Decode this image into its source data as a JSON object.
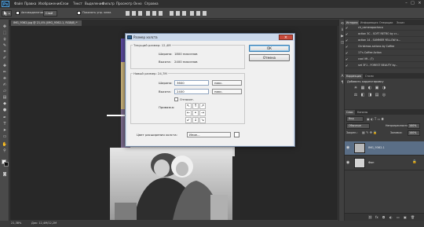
{
  "menubar": {
    "logo": "Ps",
    "items": [
      "Файл",
      "Правка",
      "Изображение",
      "Слои",
      "Текст",
      "Выделение",
      "Фильтр",
      "Просмотр",
      "Окно",
      "Справка"
    ],
    "window_controls": [
      "–",
      "□",
      "×"
    ]
  },
  "options": {
    "auto_select_label": "Автовыделение",
    "auto_select_target": "Слой",
    "show_transform_label": "Показать упр. элем."
  },
  "document": {
    "tab_label": "IMG_9362.jpg @ 21,4% (IMG_9362-1, RGB/8) *"
  },
  "status": {
    "zoom": "21,38%",
    "doc_size": "Док: 12,4M/12,2M"
  },
  "dialog": {
    "title": "Размер холста",
    "close": "×",
    "current_size": {
      "heading": "Текущий размер: 12,4M",
      "width_label": "Ширина:",
      "width_value": "1800 пикселов",
      "height_label": "Высота:",
      "height_value": "2400 пикселов"
    },
    "new_size": {
      "heading": "Новый размер: 24,7M",
      "width_label": "Ширина:",
      "width_value": "3600",
      "width_unit": "пикс.",
      "height_label": "Высота:",
      "height_value": "2400",
      "height_unit": "пикс.",
      "relative_label": "Относит.",
      "anchor_label": "Привязка:",
      "anchor_cells": [
        "↖",
        "↑",
        "↗",
        "←",
        "•",
        "→",
        "↙",
        "↓",
        "↘"
      ]
    },
    "extension_color": {
      "label": "Цвет расширения холста:",
      "value": "Иное..."
    },
    "ok_label": "ОК",
    "cancel_label": "Отмена"
  },
  "panels": {
    "top_tabs": [
      "История",
      "Информация",
      "Операции",
      "Эскиз"
    ],
    "history": [
      "ch_camerapacheco",
      "action 3C - SOFT RETRO by cr...",
      "action 14 - SUMMER YELLOW b...",
      "Christmas actions by Coffee",
      "17's Coffee Action",
      "cool lift - (?)",
      "set 3F1 - FOREST BEAUTY by..."
    ],
    "adjust_tabs": [
      "Коррекция",
      "Стили"
    ],
    "adjust_title": "Добавить корректировку",
    "adjust_icons_row1": [
      "☀",
      "▦",
      "◐",
      "▣",
      "◑"
    ],
    "adjust_icons_row2": [
      "⚖",
      "◧",
      "◨",
      "▤",
      "◎"
    ],
    "layers_tabs": [
      "Слои",
      "Каналы"
    ],
    "layers_kind": "Вид",
    "blend_mode": "Обычные",
    "opacity_label": "Непрозрачность:",
    "opacity_value": "100%",
    "lock_label": "Закреп.:",
    "fill_label": "Заливка:",
    "fill_value": "100%",
    "layers": [
      {
        "name": "IMG_9362-1"
      },
      {
        "name": "Фон"
      }
    ],
    "bottom_icons": [
      "⛓",
      "fx",
      "◘",
      "◐",
      "▭",
      "▣",
      "🗑"
    ]
  },
  "colors": {
    "dialog_bg": "#f0f0f0",
    "panel_bg": "#3c3c3c",
    "selected_layer": "#5a6e86",
    "accent_blue": "#4fa3e0"
  }
}
